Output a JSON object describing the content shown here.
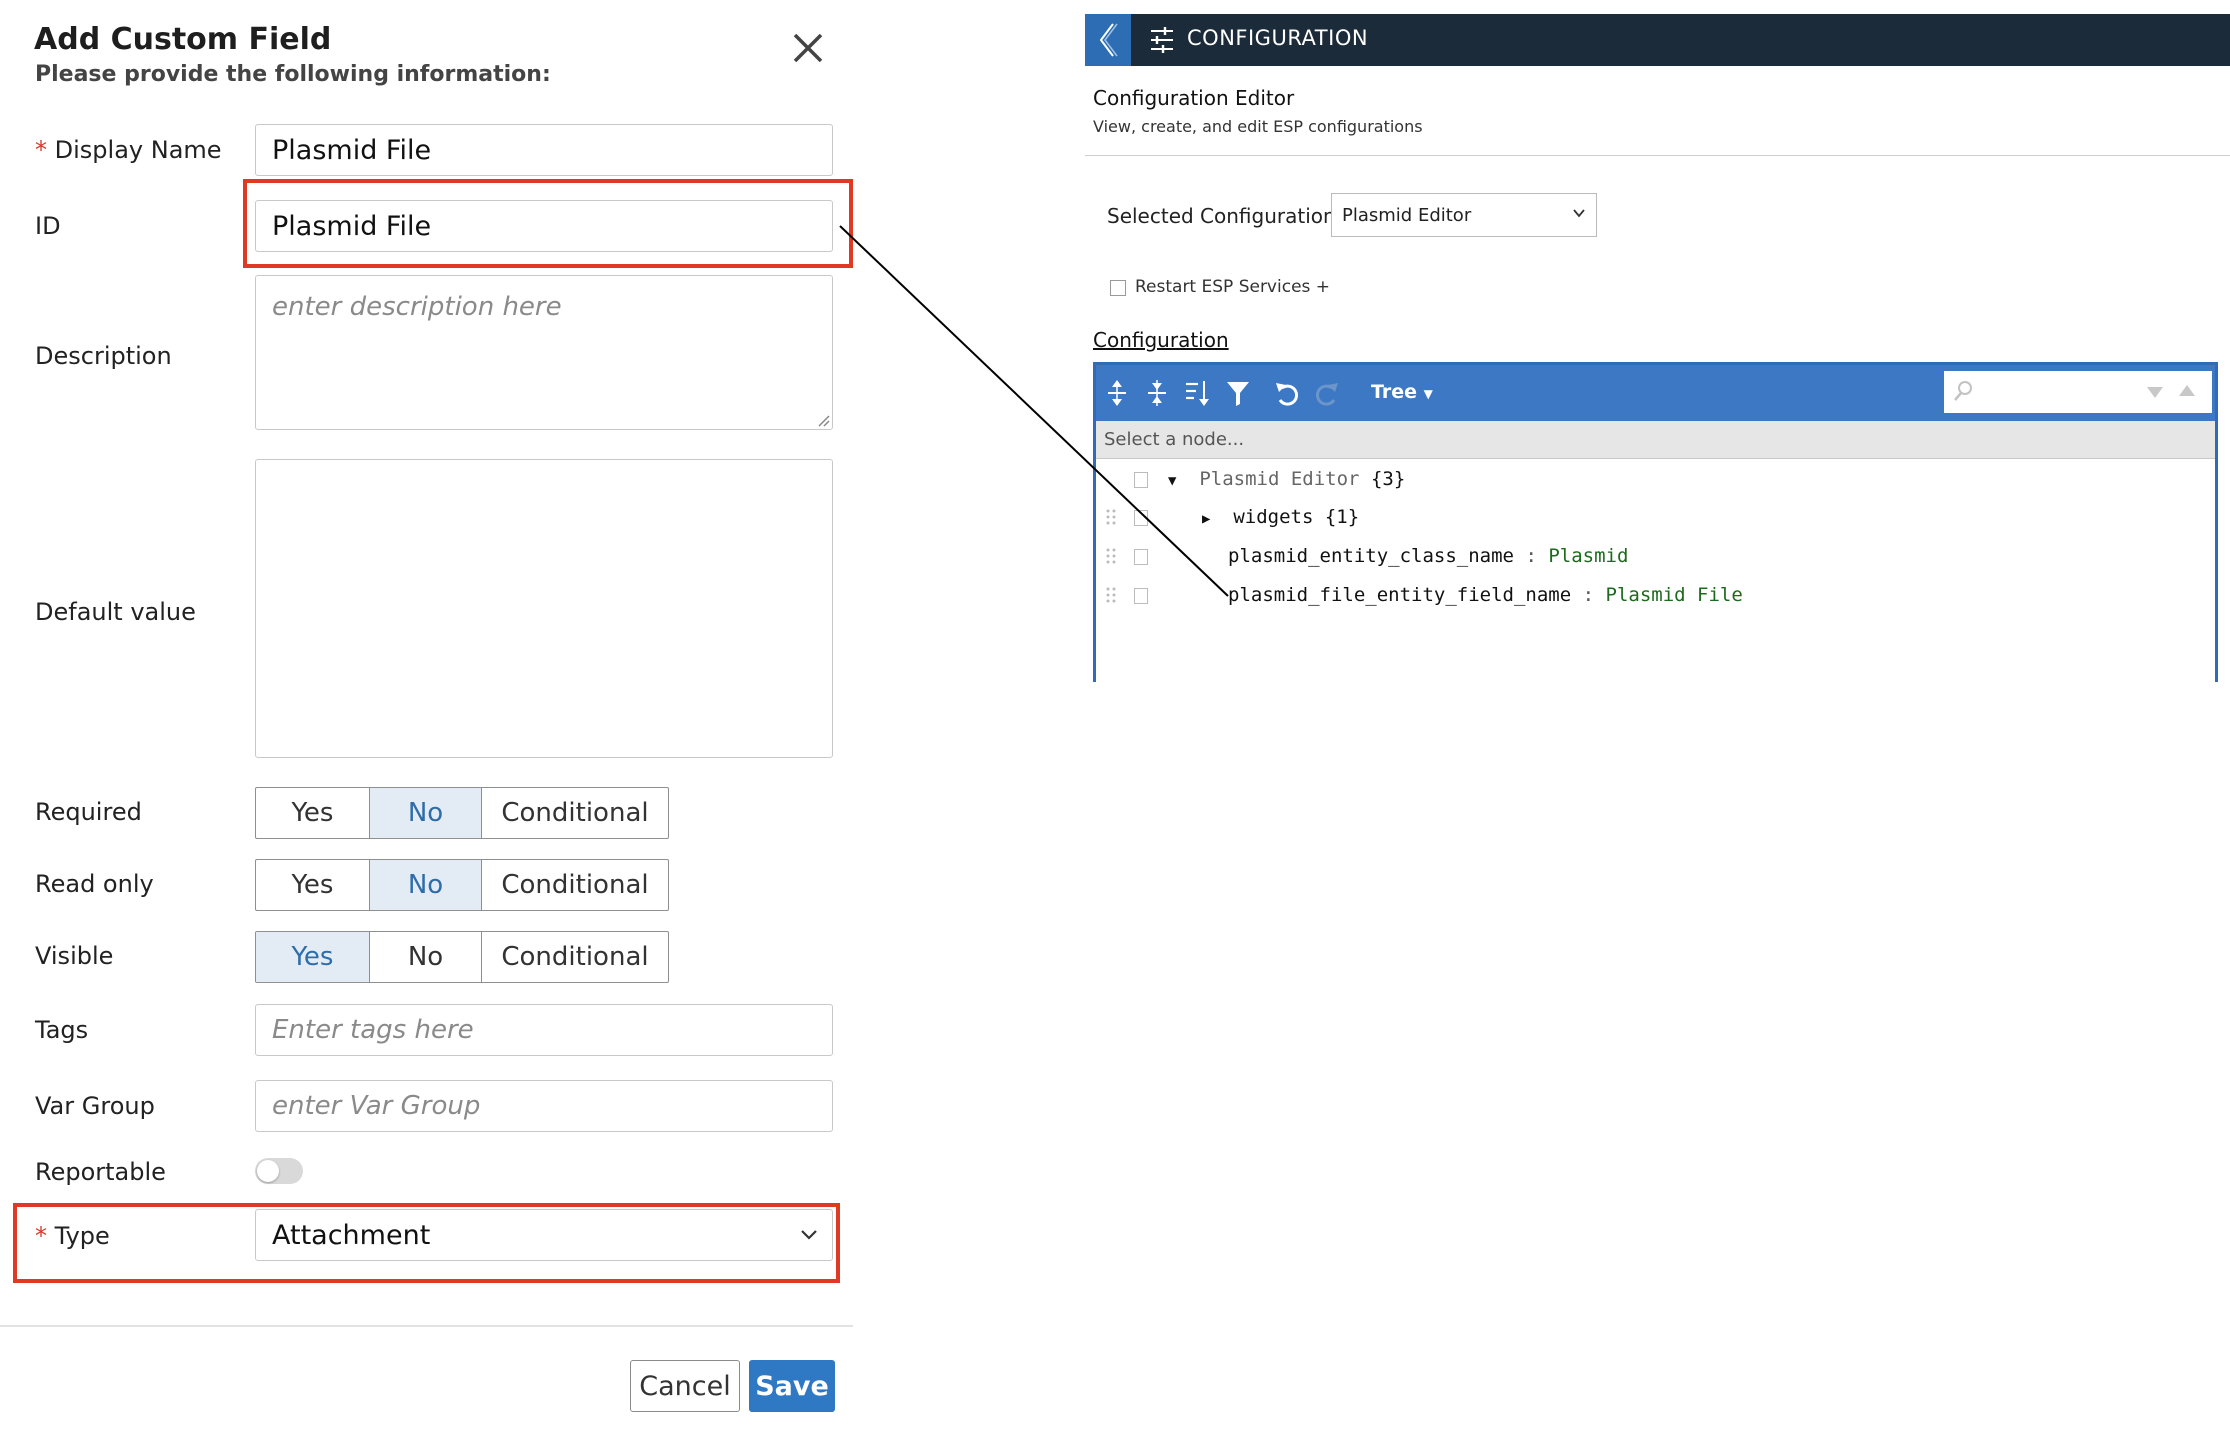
{
  "dialog": {
    "title": "Add Custom Field",
    "subtitle": "Please provide the following information:",
    "required_marker": "*",
    "fields": {
      "display_name": {
        "label": "Display Name",
        "value": "Plasmid File"
      },
      "id": {
        "label": "ID",
        "value": "Plasmid File"
      },
      "description": {
        "label": "Description",
        "placeholder": "enter description here"
      },
      "default_value": {
        "label": "Default value",
        "value": ""
      },
      "required": {
        "label": "Required",
        "options": [
          "Yes",
          "No",
          "Conditional"
        ],
        "selected": "No"
      },
      "read_only": {
        "label": "Read only",
        "options": [
          "Yes",
          "No",
          "Conditional"
        ],
        "selected": "No"
      },
      "visible": {
        "label": "Visible",
        "options": [
          "Yes",
          "No",
          "Conditional"
        ],
        "selected": "Yes"
      },
      "tags": {
        "label": "Tags",
        "placeholder": "Enter tags here"
      },
      "var_group": {
        "label": "Var Group",
        "placeholder": "enter Var Group"
      },
      "reportable": {
        "label": "Reportable",
        "on": false
      },
      "type": {
        "label": "Type",
        "value": "Attachment"
      }
    },
    "buttons": {
      "cancel": "Cancel",
      "save": "Save"
    },
    "highlight_color": "#e03a24"
  },
  "config": {
    "header_title": "CONFIGURATION",
    "editor_title": "Configuration Editor",
    "editor_subtitle": "View, create, and edit ESP configurations",
    "selected_label": "Selected Configuration:",
    "selected_value": "Plasmid Editor",
    "restart_label": "Restart ESP Services +",
    "section_label": "Configuration",
    "toolbar": {
      "mode": "Tree"
    },
    "nav_placeholder": "Select a node...",
    "tree": {
      "root": {
        "key": "Plasmid Editor",
        "count": "{3}"
      },
      "widgets": {
        "key": "widgets",
        "count": "{1}"
      },
      "class_name": {
        "key": "plasmid_entity_class_name",
        "sep": ":",
        "value": "Plasmid"
      },
      "file_field": {
        "key": "plasmid_file_entity_field_name",
        "sep": ":",
        "value": "Plasmid File"
      }
    },
    "accent_color": "#3c78c3",
    "header_color": "#1c2b3a"
  }
}
